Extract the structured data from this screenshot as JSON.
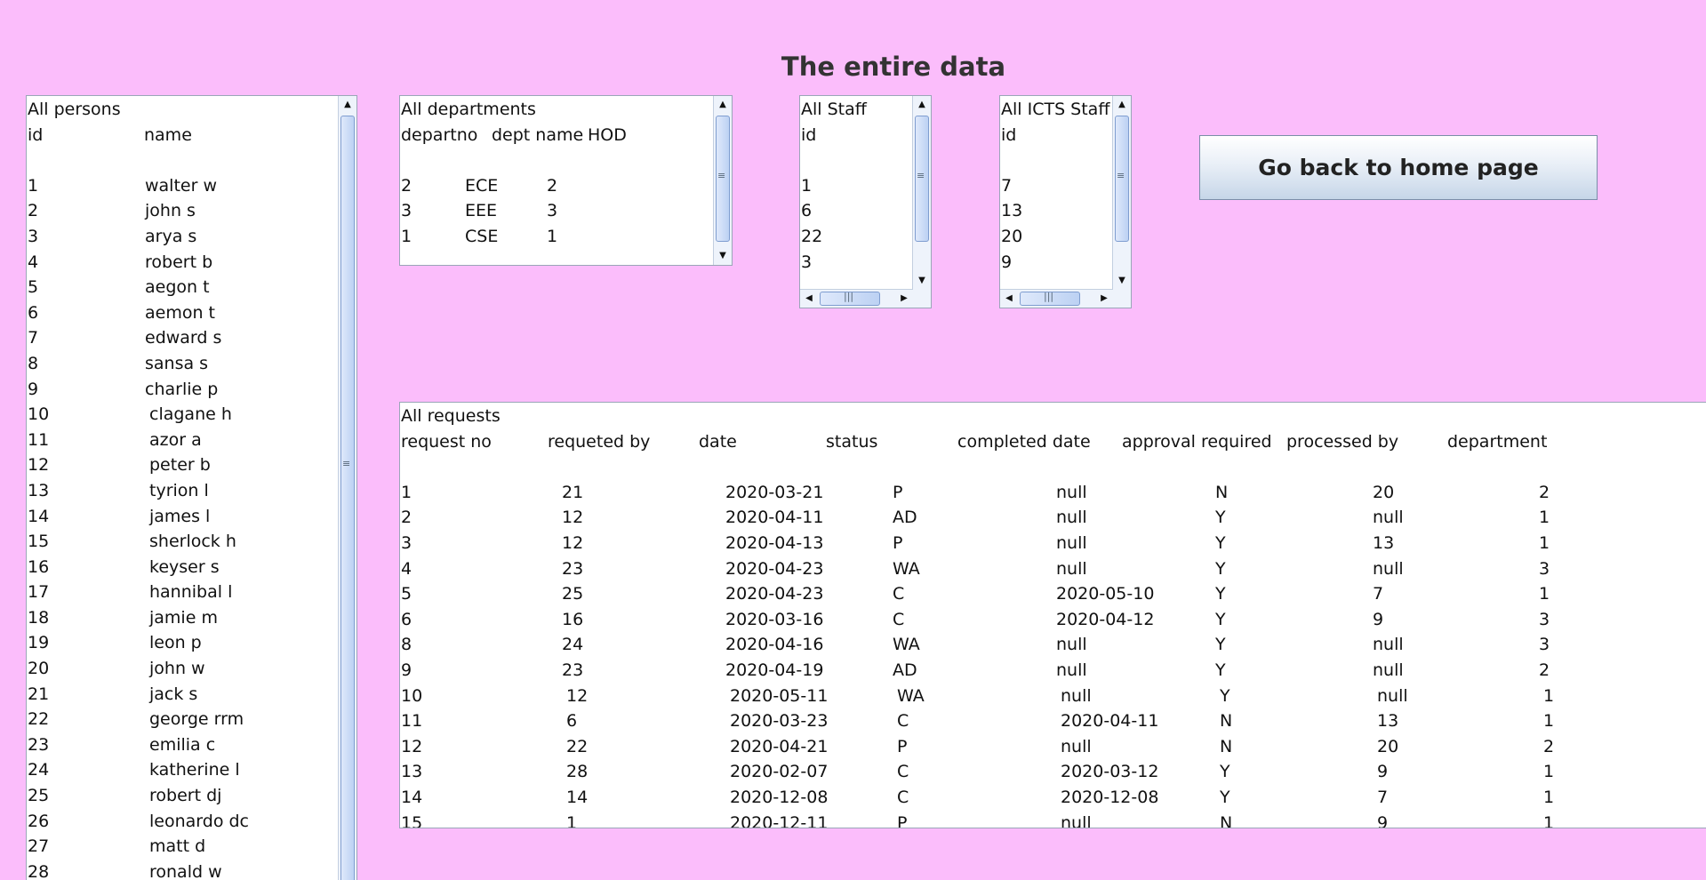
{
  "title": "The entire data",
  "persons": {
    "caption": "All persons",
    "headers": [
      "id",
      "name"
    ],
    "rows": [
      [
        "1",
        "walter w"
      ],
      [
        "2",
        "john s"
      ],
      [
        "3",
        "arya s"
      ],
      [
        "4",
        "robert b"
      ],
      [
        "5",
        "aegon t"
      ],
      [
        "6",
        "aemon t"
      ],
      [
        "7",
        "edward s"
      ],
      [
        "8",
        "sansa s"
      ],
      [
        "9",
        "charlie p"
      ],
      [
        "10",
        "clagane h"
      ],
      [
        "11",
        "azor a"
      ],
      [
        "12",
        "peter b"
      ],
      [
        "13",
        "tyrion l"
      ],
      [
        "14",
        "james l"
      ],
      [
        "15",
        "sherlock h"
      ],
      [
        "16",
        "keyser s"
      ],
      [
        "17",
        "hannibal l"
      ],
      [
        "18",
        "jamie m"
      ],
      [
        "19",
        "leon p"
      ],
      [
        "20",
        "john w"
      ],
      [
        "21",
        "jack s"
      ],
      [
        "22",
        "george rrm"
      ],
      [
        "23",
        "emilia c"
      ],
      [
        "24",
        "katherine l"
      ],
      [
        "25",
        "robert dj"
      ],
      [
        "26",
        "leonardo dc"
      ],
      [
        "27",
        "matt d"
      ],
      [
        "28",
        "ronald w"
      ]
    ]
  },
  "departments": {
    "caption": "All departments",
    "headers": [
      "departno",
      "dept name",
      "HOD"
    ],
    "rows": [
      [
        "2",
        "ECE",
        "2"
      ],
      [
        "3",
        "EEE",
        "3"
      ],
      [
        "1",
        "CSE",
        "1"
      ]
    ]
  },
  "staff": {
    "caption": "All Staff",
    "header": "id",
    "rows": [
      "1",
      "6",
      "22",
      "3"
    ]
  },
  "icts_staff": {
    "caption": "All ICTS Staff",
    "header": "id",
    "rows": [
      "7",
      "13",
      "20",
      "9"
    ]
  },
  "home_button": {
    "label": "Go back to home page"
  },
  "requests": {
    "caption": "All requests",
    "headers": [
      "request no",
      "requeted by",
      "date",
      "status",
      "completed date",
      "approval required",
      "processed by",
      "department"
    ],
    "rows": [
      [
        "1",
        "21",
        "2020-03-21",
        "P",
        "null",
        "N",
        "20",
        "2"
      ],
      [
        "2",
        "12",
        "2020-04-11",
        "AD",
        "null",
        "Y",
        "null",
        "1"
      ],
      [
        "3",
        "12",
        "2020-04-13",
        "P",
        "null",
        "Y",
        "13",
        "1"
      ],
      [
        "4",
        "23",
        "2020-04-23",
        "WA",
        "null",
        "Y",
        "null",
        "3"
      ],
      [
        "5",
        "25",
        "2020-04-23",
        "C",
        "2020-05-10",
        "Y",
        "7",
        "1"
      ],
      [
        "6",
        "16",
        "2020-03-16",
        "C",
        "2020-04-12",
        "Y",
        "9",
        "3"
      ],
      [
        "8",
        "24",
        "2020-04-16",
        "WA",
        "null",
        "Y",
        "null",
        "3"
      ],
      [
        "9",
        "23",
        "2020-04-19",
        "AD",
        "null",
        "Y",
        "null",
        "2"
      ],
      [
        "10",
        "12",
        "2020-05-11",
        "WA",
        "null",
        "Y",
        "null",
        "1"
      ],
      [
        "11",
        "6",
        "2020-03-23",
        "C",
        "2020-04-11",
        "N",
        "13",
        "1"
      ],
      [
        "12",
        "22",
        "2020-04-21",
        "P",
        "null",
        "N",
        "20",
        "2"
      ],
      [
        "13",
        "28",
        "2020-02-07",
        "C",
        "2020-03-12",
        "Y",
        "9",
        "1"
      ],
      [
        "14",
        "14",
        "2020-12-08",
        "C",
        "2020-12-08",
        "Y",
        "7",
        "1"
      ],
      [
        "15",
        "1",
        "2020-12-11",
        "P",
        "null",
        "N",
        "9",
        "1"
      ]
    ]
  }
}
